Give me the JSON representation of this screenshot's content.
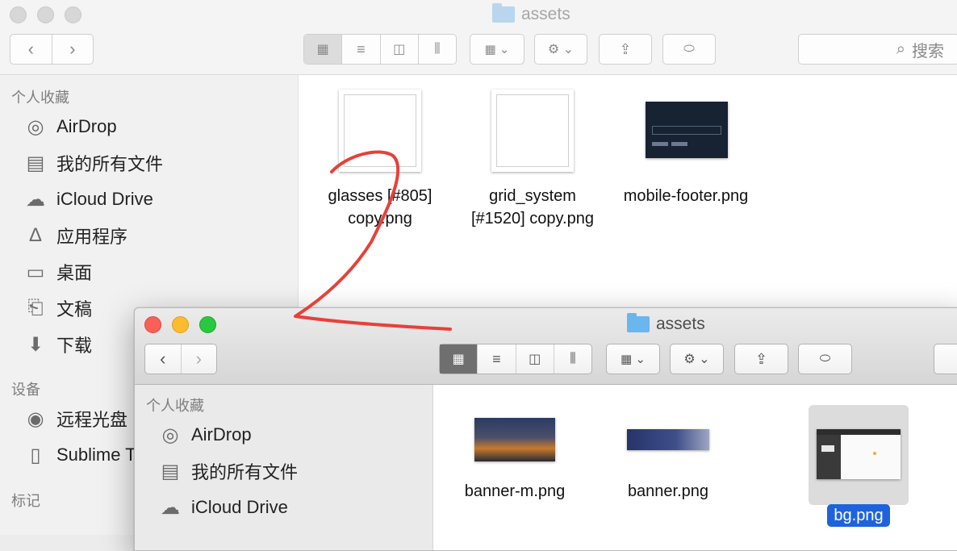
{
  "back_window": {
    "title": "assets",
    "search_placeholder": "搜索",
    "sidebar": {
      "favorites_header": "个人收藏",
      "favorites": [
        "AirDrop",
        "我的所有文件",
        "iCloud Drive",
        "应用程序",
        "桌面",
        "文稿",
        "下载"
      ],
      "devices_header": "设备",
      "devices": [
        "远程光盘",
        "Sublime T"
      ],
      "tags_header": "标记"
    },
    "files": [
      {
        "line1": "glasses [#805]",
        "line2": "copy.png"
      },
      {
        "line1": "grid_system",
        "line2": "[#1520] copy.png"
      },
      {
        "line1": "mobile-footer.png",
        "line2": ""
      }
    ]
  },
  "front_window": {
    "title": "assets",
    "sidebar": {
      "favorites_header": "个人收藏",
      "favorites": [
        "AirDrop",
        "我的所有文件",
        "iCloud Drive"
      ]
    },
    "files": [
      {
        "name": "banner-m.png"
      },
      {
        "name": "banner.png"
      },
      {
        "name": "bg.png",
        "selected": true
      }
    ]
  },
  "icons": {
    "back": "chevron-left",
    "forward": "chevron-right",
    "view_icon": "grid-icon",
    "view_list": "list-icon",
    "view_column": "columns-icon",
    "view_flow": "coverflow-icon",
    "arrange": "arrange-icon",
    "action": "gear-icon",
    "share": "share-icon",
    "tag": "tag-icon",
    "search": "search-icon"
  },
  "annotation_color": "#e8403a",
  "selection_color": "#1f63dc"
}
